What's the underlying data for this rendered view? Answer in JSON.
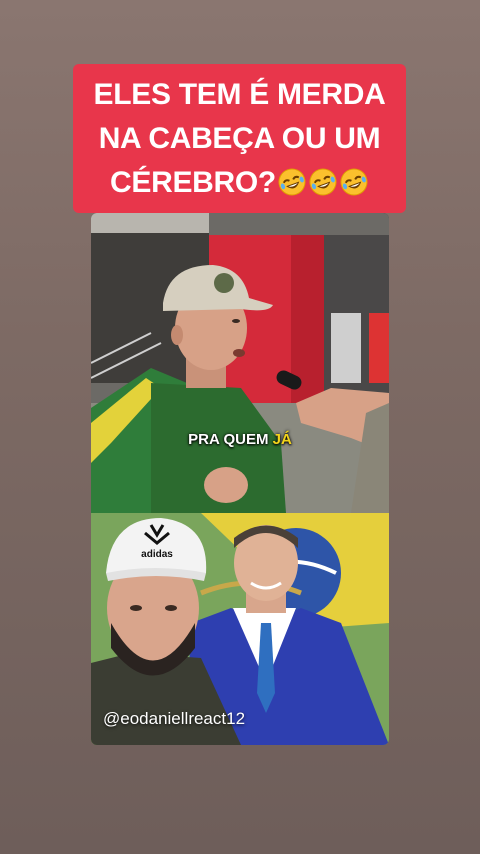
{
  "caption": {
    "line1": "ELES TEM É MERDA",
    "line2": "NA CABEÇA OU UM",
    "line3": "CÉREBRO?",
    "emoji": "rolling-on-floor-laughing-emoji",
    "emoji_count": 3,
    "background_color": "#e8364b"
  },
  "video": {
    "subtitle_prefix": "PRA QUEM ",
    "subtitle_highlight": "JÁ",
    "highlight_color": "#f2d31b",
    "watermark": "@eodaniellreact12",
    "cap_logo_text": "adidas"
  }
}
